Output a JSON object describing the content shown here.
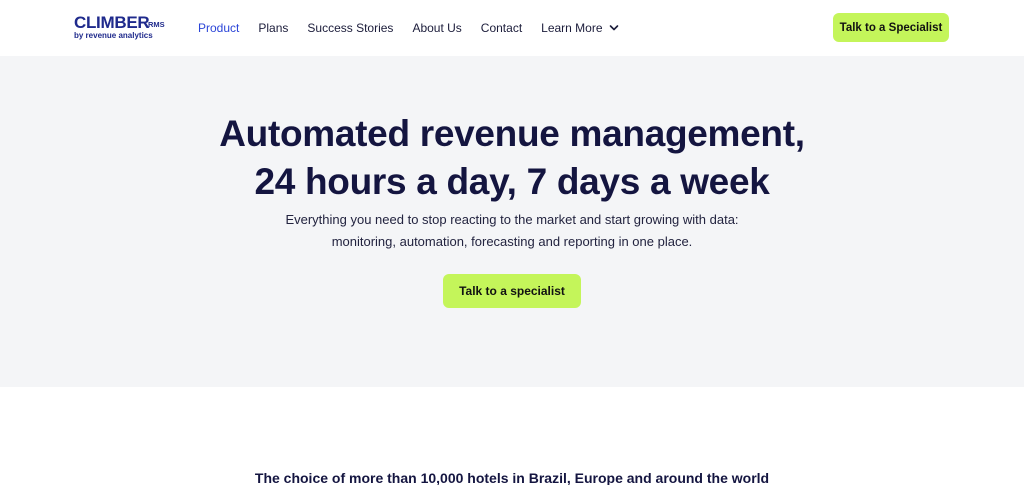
{
  "brand": {
    "name": "CLIMBER",
    "suffix": "RMS",
    "tagline": "by revenue analytics"
  },
  "nav": {
    "items": [
      {
        "label": "Product",
        "active": true
      },
      {
        "label": "Plans"
      },
      {
        "label": "Success Stories"
      },
      {
        "label": "About Us"
      },
      {
        "label": "Contact"
      },
      {
        "label": "Learn More"
      }
    ],
    "cta_label": "Talk to a Specialist"
  },
  "hero": {
    "title_line1": "Automated revenue management,",
    "title_line2": "24 hours a day, 7 days a week",
    "subtitle_line1": "Everything you need to stop reacting to the market and start growing with data:",
    "subtitle_line2": "monitoring, automation, forecasting and reporting in one place.",
    "cta_label": "Talk to a specialist"
  },
  "trust": {
    "heading": "The choice of more than 10,000 hotels in Brazil, Europe and around the world"
  },
  "colors": {
    "accent": "#c4f55a",
    "brand_blue": "#1f2a8c",
    "active_link": "#2b45d8",
    "hero_bg": "#f4f5f7",
    "heading": "#141540"
  },
  "icons": {
    "learn_more_dropdown": "chevron-down-icon"
  }
}
